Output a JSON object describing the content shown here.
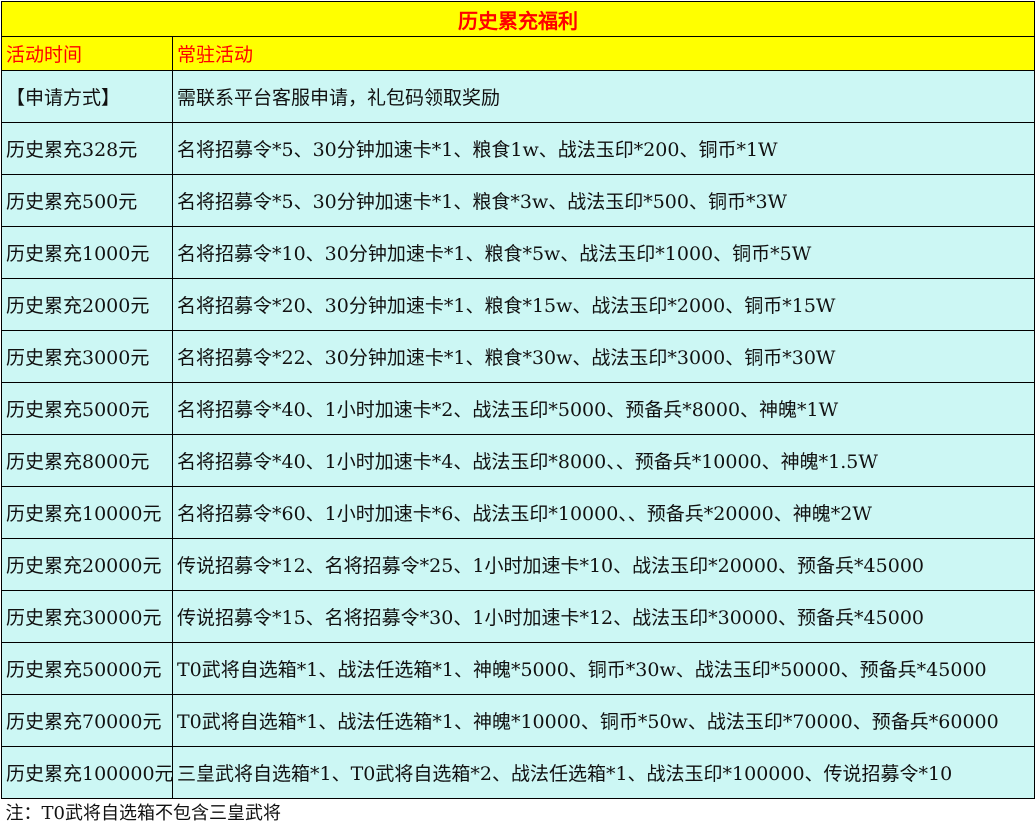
{
  "title": "历史累充福利",
  "header": {
    "col1": "活动时间",
    "col2": "常驻活动"
  },
  "rows": [
    {
      "tier": "【申请方式】",
      "reward": "需联系平台客服申请，礼包码领取奖励"
    },
    {
      "tier": "历史累充328元",
      "reward": "名将招募令*5、30分钟加速卡*1、粮食1w、战法玉印*200、铜币*1W"
    },
    {
      "tier": "历史累充500元",
      "reward": "名将招募令*5、30分钟加速卡*1、粮食*3w、战法玉印*500、铜币*3W"
    },
    {
      "tier": "历史累充1000元",
      "reward": "名将招募令*10、30分钟加速卡*1、粮食*5w、战法玉印*1000、铜币*5W"
    },
    {
      "tier": "历史累充2000元",
      "reward": "名将招募令*20、30分钟加速卡*1、粮食*15w、战法玉印*2000、铜币*15W"
    },
    {
      "tier": "历史累充3000元",
      "reward": "名将招募令*22、30分钟加速卡*1、粮食*30w、战法玉印*3000、铜币*30W"
    },
    {
      "tier": "历史累充5000元",
      "reward": "名将招募令*40、1小时加速卡*2、战法玉印*5000、预备兵*8000、神魄*1W"
    },
    {
      "tier": "历史累充8000元",
      "reward": "名将招募令*40、1小时加速卡*4、战法玉印*8000、、预备兵*10000、神魄*1.5W"
    },
    {
      "tier": "历史累充10000元",
      "reward": "名将招募令*60、1小时加速卡*6、战法玉印*10000、、预备兵*20000、神魄*2W"
    },
    {
      "tier": "历史累充20000元",
      "reward": "传说招募令*12、名将招募令*25、1小时加速卡*10、战法玉印*20000、预备兵*45000"
    },
    {
      "tier": "历史累充30000元",
      "reward": "传说招募令*15、名将招募令*30、1小时加速卡*12、战法玉印*30000、预备兵*45000"
    },
    {
      "tier": "历史累充50000元",
      "reward": "T0武将自选箱*1、战法任选箱*1、神魄*5000、铜币*30w、战法玉印*50000、预备兵*45000"
    },
    {
      "tier": "历史累充70000元",
      "reward": "T0武将自选箱*1、战法任选箱*1、神魄*10000、铜币*50w、战法玉印*70000、预备兵*60000"
    },
    {
      "tier": "历史累充100000元",
      "reward": "三皇武将自选箱*1、T0武将自选箱*2、战法任选箱*1、战法玉印*100000、传说招募令*10"
    }
  ],
  "note": "注：T0武将自选箱不包含三皇武将"
}
